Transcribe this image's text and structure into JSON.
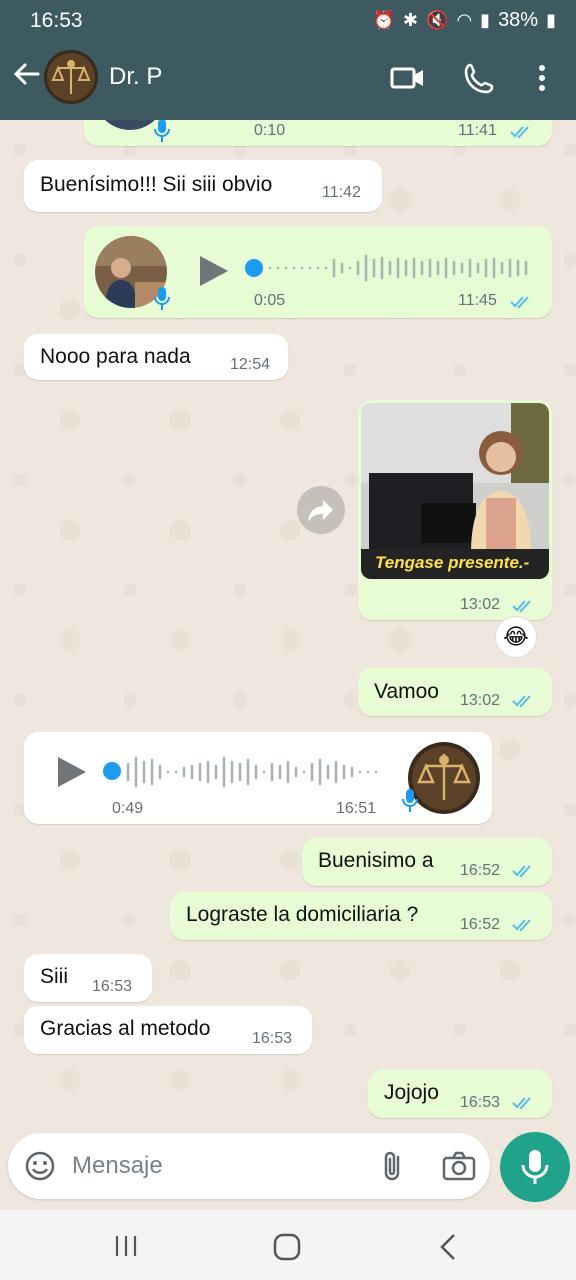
{
  "status_bar": {
    "time": "16:53",
    "battery": "38%"
  },
  "header": {
    "contact_name": "Dr. P"
  },
  "messages": {
    "voice_top": {
      "duration": "0:10",
      "time": "11:41"
    },
    "m1": {
      "text": "Buenísimo!!! Sii siii obvio",
      "time": "11:42"
    },
    "voice_1": {
      "duration": "0:05",
      "time": "11:45"
    },
    "m2": {
      "text": "Nooo para nada",
      "time": "12:54"
    },
    "image_1": {
      "caption_in_image": "Tengase presente.-",
      "time": "13:02",
      "reaction": "😂"
    },
    "m3": {
      "text": "Vamoo",
      "time": "13:02"
    },
    "voice_2": {
      "duration": "0:49",
      "time": "16:51"
    },
    "m4": {
      "text": "Buenisimo a",
      "time": "16:52"
    },
    "m5": {
      "text": "Lograste la domiciliaria ?",
      "time": "16:52"
    },
    "m6": {
      "text": "Siii",
      "time": "16:53"
    },
    "m7": {
      "text": "Gracias al metodo",
      "time": "16:53"
    },
    "m8": {
      "text": "Jojojo",
      "time": "16:53"
    }
  },
  "composer": {
    "placeholder": "Mensaje"
  },
  "colors": {
    "header": "#3d5a60",
    "outgoing_bubble": "#e7fcd5",
    "incoming_bubble": "#ffffff",
    "read_tick": "#53bdeb",
    "mic_button": "#1fa38a"
  },
  "icons": [
    "back-arrow-icon",
    "video-call-icon",
    "phone-icon",
    "more-vert-icon",
    "play-icon",
    "mic-icon",
    "forward-icon",
    "emoji-icon",
    "attach-icon",
    "camera-icon",
    "double-tick-icon"
  ]
}
